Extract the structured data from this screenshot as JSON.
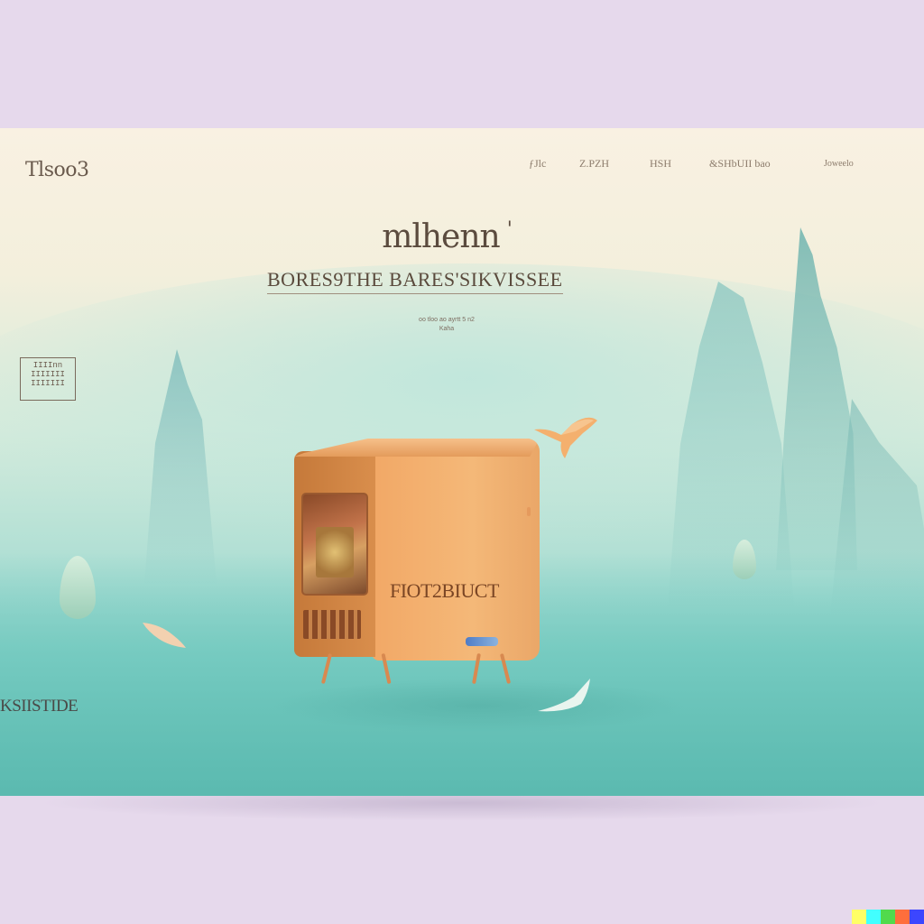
{
  "header": {
    "logo": "Tlsoo3",
    "nav": [
      {
        "label": "ƒJlc"
      },
      {
        "label": "Z.PZH"
      },
      {
        "label": "HSH"
      },
      {
        "label": "&SHbUII bao"
      },
      {
        "label": "Joweelo"
      }
    ]
  },
  "hero": {
    "title": "mlhenn",
    "title_mark": "'",
    "subtitle": "BORES9THE BARES'SIKVISSEE",
    "caption_line1": "oo tloo ao ayrtt 5 n2",
    "caption_line2": "Kaha"
  },
  "side": {
    "badge_line1": "IIIInn",
    "badge_line2": "IIIIIII",
    "badge_line3": "IIIIIII",
    "label": "KSIISTIDE"
  },
  "product": {
    "label": "FIOT2BIUCT",
    "icon": "vintage-computer-box-icon"
  },
  "colors": {
    "background": "#e6d9ec",
    "header_bg": "#f9f1e2",
    "teal": "#6cc4b8",
    "box_orange": "#f2a866",
    "text_brown": "#5b4b3e"
  },
  "watermark_colors": [
    "#ffff66",
    "#42ffff",
    "#51da4c",
    "#ff6e3c",
    "#3c46ff"
  ]
}
